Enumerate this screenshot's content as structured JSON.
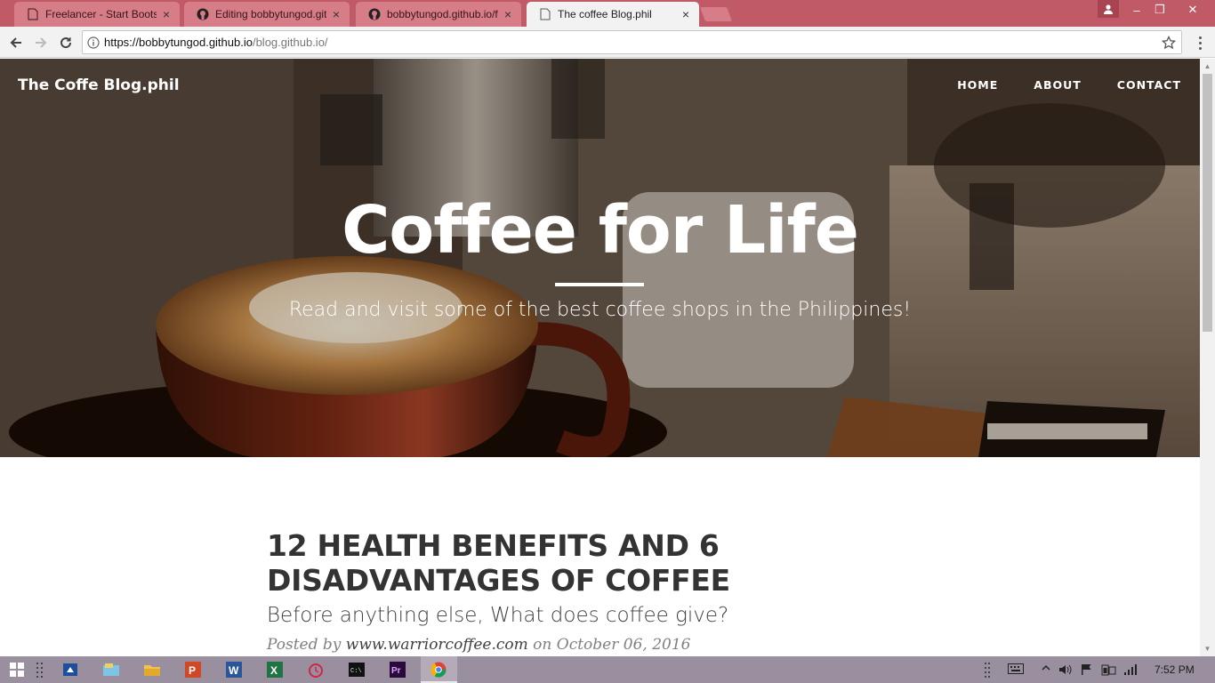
{
  "browser": {
    "tabs": [
      {
        "title": "Freelancer - Start Bootstr",
        "active": false,
        "icon": "page-icon"
      },
      {
        "title": "Editing bobbytungod.gith",
        "active": false,
        "icon": "github-icon"
      },
      {
        "title": "bobbytungod.github.io/f",
        "active": false,
        "icon": "github-icon"
      },
      {
        "title": "The coffee Blog.phil",
        "active": true,
        "icon": "page-icon"
      }
    ],
    "tab_close": "×",
    "url_host": "https://bobbytungod.github.io",
    "url_path": "/blog.github.io/",
    "window_controls": [
      "–",
      "❐",
      "✕"
    ]
  },
  "site": {
    "brand": "The Coffe Blog.phil",
    "nav": [
      "HOME",
      "ABOUT",
      "CONTACT"
    ],
    "hero_title": "Coffee for Life",
    "hero_subtitle": "Read and visit some of the best coffee shops in the Philippines!"
  },
  "post": {
    "title_line1": "12 HEALTH BENEFITS AND 6",
    "title_line2": "DISADVANTAGES OF COFFEE",
    "subtitle": "Before anything else, What does coffee give?",
    "meta_prefix": "Posted by ",
    "author": "www.warriorcoffee.com",
    "meta_on": " on October 06, 2016"
  },
  "taskbar": {
    "clock": "7:52 PM",
    "apps": [
      "start-icon",
      "task-view-icon",
      "onedrive-icon",
      "file-explorer-icon",
      "powerpoint-icon",
      "word-icon",
      "excel-icon",
      "alarm-icon",
      "cmd-icon",
      "premiere-icon",
      "chrome-icon"
    ]
  },
  "colors": {
    "tabstrip": "#c15a67",
    "taskbar": "#9a8f9e",
    "post_title": "#333333"
  }
}
